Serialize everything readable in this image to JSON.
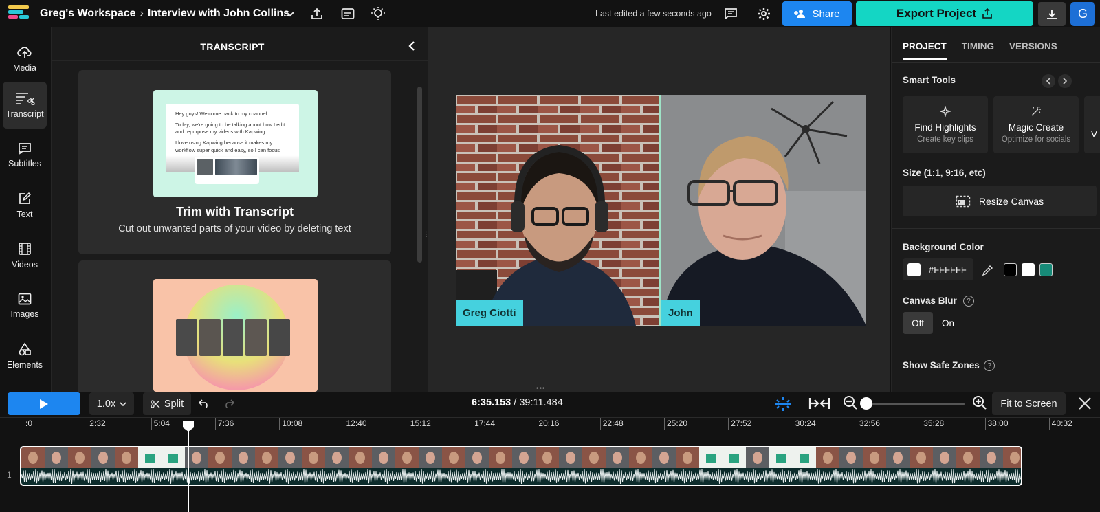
{
  "topbar": {
    "workspace": "Greg's Workspace",
    "separator": "›",
    "project_title": "Interview with John Collins",
    "last_edited": "Last edited a few seconds ago",
    "share_label": "Share",
    "export_label": "Export Project",
    "avatar_initial": "G",
    "icons": [
      "upload-icon",
      "captions-icon",
      "lightbulb-icon",
      "comment-icon",
      "gear-icon",
      "download-icon"
    ]
  },
  "leftnav": {
    "items": [
      {
        "label": "Media",
        "icon": "upload-cloud-icon"
      },
      {
        "label": "Transcript",
        "icon": "transcript-icon",
        "active": true
      },
      {
        "label": "Subtitles",
        "icon": "subtitles-icon"
      },
      {
        "label": "Text",
        "icon": "text-edit-icon"
      },
      {
        "label": "Videos",
        "icon": "film-icon"
      },
      {
        "label": "Images",
        "icon": "image-icon"
      },
      {
        "label": "Elements",
        "icon": "shapes-icon"
      }
    ]
  },
  "transcript_panel": {
    "title": "TRANSCRIPT",
    "card1": {
      "title": "Trim with Transcript",
      "subtitle": "Cut out unwanted parts of your video by deleting text",
      "preview_text": [
        "Hey guys! Welcome back to my channel.",
        "Today, we're going to be talking about how I edit and repurpose my videos with Kapwing.",
        "I love using Kapwing because it makes my workflow super quick and easy, so I can focus"
      ],
      "preview_bg": "#cdf5e6"
    },
    "card2": {
      "preview_bg": "#f9c3a8"
    }
  },
  "stage": {
    "left_speaker": "Greg Ciotti",
    "right_speaker": "John",
    "tag_color": "#45d1de"
  },
  "right_panel": {
    "tabs": [
      "PROJECT",
      "TIMING",
      "VERSIONS"
    ],
    "active_tab": "PROJECT",
    "smart_tools_label": "Smart Tools",
    "tools": [
      {
        "title": "Find Highlights",
        "subtitle": "Create key clips",
        "icon": "sparkle-icon"
      },
      {
        "title": "Magic Create",
        "subtitle": "Optimize for socials",
        "icon": "magic-wand-icon"
      },
      {
        "title": "V",
        "subtitle": "",
        "icon": "partial-tool-icon"
      }
    ],
    "size_label": "Size (1:1, 9:16, etc)",
    "resize_label": "Resize Canvas",
    "bg_color_label": "Background Color",
    "bg_color_value": "#FFFFFF",
    "swatches": [
      "#000000",
      "#ffffff",
      "#178a78"
    ],
    "canvas_blur_label": "Canvas Blur",
    "blur_options": [
      "Off",
      "On"
    ],
    "blur_selected": "Off",
    "safe_zones_label": "Show Safe Zones"
  },
  "timeline": {
    "speed": "1.0x",
    "split_label": "Split",
    "current_time": "6:35.153",
    "separator": " / ",
    "total_time": "39:11.484",
    "fit_label": "Fit to Screen",
    "zoom_level": 0,
    "ruler_ticks": [
      ":0",
      "2:32",
      "5:04",
      "7:36",
      "10:08",
      "12:40",
      "15:12",
      "17:44",
      "20:16",
      "22:48",
      "25:20",
      "27:52",
      "30:24",
      "32:56",
      "35:28",
      "38:00",
      "40:32"
    ],
    "track_number": "1",
    "playhead_time": "6:35.153"
  },
  "colors": {
    "accent_blue": "#1d86f0",
    "export_teal": "#14d6c4",
    "avatar_blue": "#1d6fd6"
  }
}
